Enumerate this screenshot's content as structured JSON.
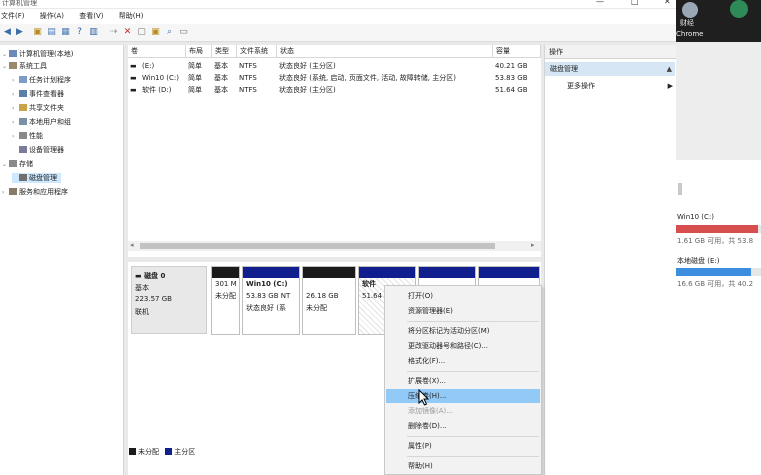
{
  "window": {
    "title": "计算机管理"
  },
  "menu": [
    "文件(F)",
    "操作(A)",
    "查看(V)",
    "帮助(H)"
  ],
  "tree": [
    {
      "label": "计算机管理(本地)",
      "icon": "computer-management-icon"
    },
    {
      "label": "系统工具",
      "icon": "tools-icon"
    },
    {
      "label": "任务计划程序",
      "icon": "task-scheduler-icon"
    },
    {
      "label": "事件查看器",
      "icon": "event-viewer-icon"
    },
    {
      "label": "共享文件夹",
      "icon": "shared-folder-icon"
    },
    {
      "label": "本地用户和组",
      "icon": "users-icon"
    },
    {
      "label": "性能",
      "icon": "performance-icon"
    },
    {
      "label": "设备管理器",
      "icon": "device-manager-icon"
    },
    {
      "label": "存储",
      "icon": "storage-icon"
    },
    {
      "label": "磁盘管理",
      "icon": "disk-management-icon"
    },
    {
      "label": "服务和应用程序",
      "icon": "services-icon"
    }
  ],
  "volumes": {
    "headers": [
      "卷",
      "布局",
      "类型",
      "文件系统",
      "状态",
      "容量"
    ],
    "rows": [
      [
        "(E:)",
        "简单",
        "基本",
        "NTFS",
        "状态良好 (主分区)",
        "40.21 GB"
      ],
      [
        "Win10 (C:)",
        "简单",
        "基本",
        "NTFS",
        "状态良好 (系统, 启动, 页面文件, 活动, 故障转储, 主分区)",
        "53.83 GB"
      ],
      [
        "软件 (D:)",
        "简单",
        "基本",
        "NTFS",
        "状态良好 (主分区)",
        "51.64 GB"
      ]
    ]
  },
  "disk0": {
    "name": "磁盘 0",
    "type": "基本",
    "size": "223.57 GB",
    "status": "联机"
  },
  "partitions": [
    {
      "name": "",
      "size": "301 M",
      "status": "未分配"
    },
    {
      "name": "Win10 (C:)",
      "size": "53.83 GB NT",
      "status": "状态良好 (系"
    },
    {
      "name": "",
      "size": "26.18 GB",
      "status": "未分配"
    },
    {
      "name": "软件",
      "size": "51.64",
      "status": ""
    },
    {
      "name": "",
      "size": "",
      "status": ""
    },
    {
      "name": "",
      "size": "",
      "status": ""
    }
  ],
  "legend": [
    "未分配",
    "主分区"
  ],
  "actions": {
    "header": "操作",
    "section": "磁盘管理",
    "more": "更多操作"
  },
  "context_menu": [
    "打开(O)",
    "资源管理器(E)",
    "将分区标记为活动分区(M)",
    "更改驱动器号和路径(C)...",
    "格式化(F)...",
    "扩展卷(X)...",
    "压缩卷(H)...",
    "添加镜像(A)...",
    "删除卷(D)...",
    "属性(P)",
    "帮助(H)"
  ],
  "taskbar": {
    "tray_labels": [
      "财经",
      "Chrome"
    ],
    "drive_c": {
      "name": "Win10 (C:)",
      "info": "1.61 GB 可用，共 53.8"
    },
    "drive_e": {
      "name": "本地磁盘 (E:)",
      "info": "16.6 GB 可用，共 40.2"
    }
  },
  "colors": {
    "primary": "#101e8e",
    "unalloc": "#1a1a1a",
    "highlight": "#91c9f7",
    "red": "#d74e4e",
    "blue": "#3e8ee0"
  }
}
